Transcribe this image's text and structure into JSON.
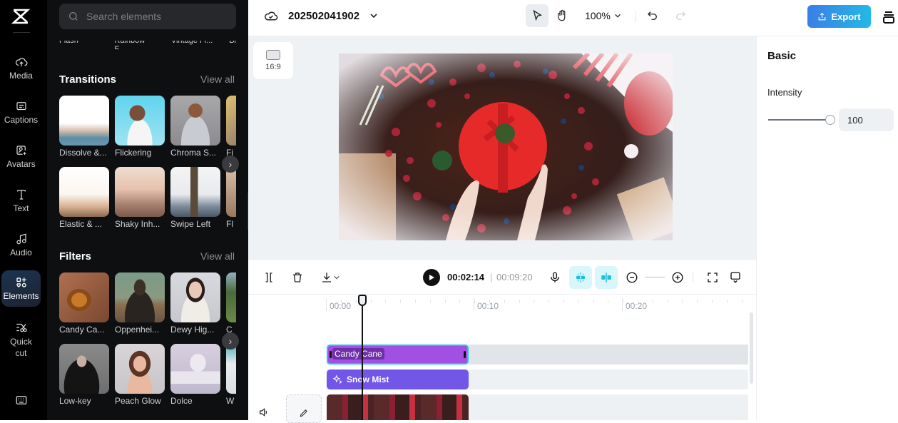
{
  "nav": {
    "logo": "capcut-logo",
    "items": [
      {
        "label": "Media",
        "icon": "cloud-upload-icon"
      },
      {
        "label": "Captions",
        "icon": "captions-icon"
      },
      {
        "label": "Avatars",
        "icon": "avatar-icon"
      },
      {
        "label": "Text",
        "icon": "text-icon"
      },
      {
        "label": "Audio",
        "icon": "music-icon"
      },
      {
        "label": "Elements",
        "icon": "elements-icon",
        "active": true
      },
      {
        "label": "Quick cut",
        "icon": "quick-cut-icon"
      }
    ],
    "bottom_icon": "keyboard-icon"
  },
  "panel": {
    "search_placeholder": "Search elements",
    "cut_labels": [
      "Flash",
      "Rainbow F...",
      "Vintage Fi...",
      "Bl"
    ],
    "transitions": {
      "title": "Transitions",
      "view_all": "View all",
      "items": [
        {
          "label": "Dissolve &..."
        },
        {
          "label": "Flickering"
        },
        {
          "label": "Chroma S..."
        },
        {
          "label": "Fi"
        },
        {
          "label": "Elastic & ..."
        },
        {
          "label": "Shaky Inh..."
        },
        {
          "label": "Swipe Left"
        },
        {
          "label": "Fl"
        }
      ]
    },
    "filters": {
      "title": "Filters",
      "view_all": "View all",
      "items": [
        {
          "label": "Candy Ca..."
        },
        {
          "label": "Oppenhei..."
        },
        {
          "label": "Dewy Hig..."
        },
        {
          "label": "C"
        },
        {
          "label": "Low-key"
        },
        {
          "label": "Peach Glow"
        },
        {
          "label": "Dolce"
        },
        {
          "label": "W"
        }
      ]
    }
  },
  "topbar": {
    "project_name": "202502041902",
    "zoom": "100%",
    "export_label": "Export"
  },
  "canvas": {
    "aspect_ratio": "16:9"
  },
  "properties": {
    "section": "Basic",
    "intensity_label": "Intensity",
    "intensity_value": "100",
    "intensity_fraction": 1.0
  },
  "timeline_toolbar": {
    "current_time": "00:02:14",
    "separator": "|",
    "total_time": "00:09:20"
  },
  "timeline": {
    "ruler": [
      "00:00",
      "00:10",
      "00:20"
    ],
    "clips": [
      {
        "label": "Candy Cane",
        "type": "filter",
        "color": "#a24fe3"
      },
      {
        "label": "Snow Mist",
        "type": "effect",
        "color": "#7156e8"
      },
      {
        "label": "",
        "type": "video"
      }
    ]
  },
  "colors": {
    "accent": "#23b9e6",
    "export_start": "#3b7ee6",
    "selected_outline": "#1ec8dc"
  }
}
